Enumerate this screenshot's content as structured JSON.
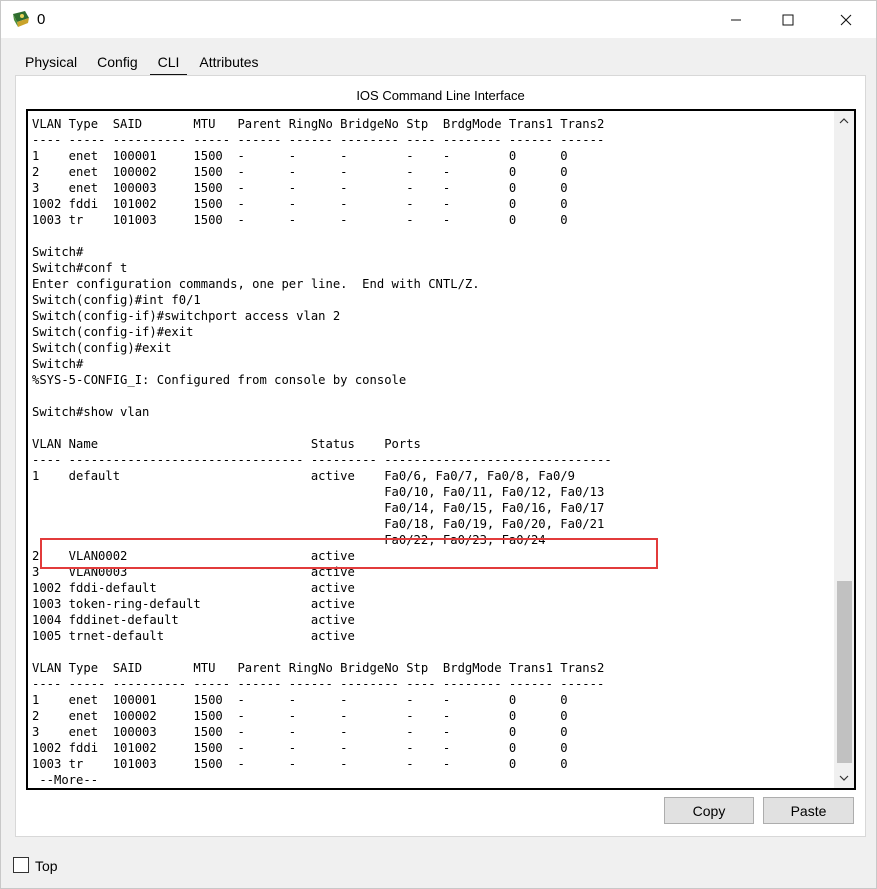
{
  "window": {
    "title": "0",
    "icon": "packet-tracer-switch-icon",
    "controls": [
      "minimize-icon",
      "maximize-icon",
      "close-icon"
    ]
  },
  "tabs": [
    {
      "label": "Physical",
      "active": false
    },
    {
      "label": "Config",
      "active": false
    },
    {
      "label": "CLI",
      "active": true
    },
    {
      "label": "Attributes",
      "active": false
    }
  ],
  "panel": {
    "title": "IOS Command Line Interface"
  },
  "terminal": {
    "lines": [
      "VLAN Type  SAID       MTU   Parent RingNo BridgeNo Stp  BrdgMode Trans1 Trans2",
      "---- ----- ---------- ----- ------ ------ -------- ---- -------- ------ ------",
      "1    enet  100001     1500  -      -      -        -    -        0      0",
      "2    enet  100002     1500  -      -      -        -    -        0      0",
      "3    enet  100003     1500  -      -      -        -    -        0      0",
      "1002 fddi  101002     1500  -      -      -        -    -        0      0",
      "1003 tr    101003     1500  -      -      -        -    -        0      0",
      "",
      "Switch#",
      "Switch#conf t",
      "Enter configuration commands, one per line.  End with CNTL/Z.",
      "Switch(config)#int f0/1",
      "Switch(config-if)#switchport access vlan 2",
      "Switch(config-if)#exit",
      "Switch(config)#exit",
      "Switch#",
      "%SYS-5-CONFIG_I: Configured from console by console",
      "",
      "Switch#show vlan",
      "",
      "VLAN Name                             Status    Ports",
      "---- -------------------------------- --------- -------------------------------",
      "1    default                          active    Fa0/6, Fa0/7, Fa0/8, Fa0/9",
      "                                                Fa0/10, Fa0/11, Fa0/12, Fa0/13",
      "                                                Fa0/14, Fa0/15, Fa0/16, Fa0/17",
      "                                                Fa0/18, Fa0/19, Fa0/20, Fa0/21",
      "                                                Fa0/22, Fa0/23, Fa0/24",
      "2    VLAN0002                         active",
      "3    VLAN0003                         active",
      "1002 fddi-default                     active",
      "1003 token-ring-default               active",
      "1004 fddinet-default                  active",
      "1005 trnet-default                    active",
      "",
      "VLAN Type  SAID       MTU   Parent RingNo BridgeNo Stp  BrdgMode Trans1 Trans2",
      "---- ----- ---------- ----- ------ ------ -------- ---- -------- ------ ------",
      "1    enet  100001     1500  -      -      -        -    -        0      0",
      "2    enet  100002     1500  -      -      -        -    -        0      0",
      "3    enet  100003     1500  -      -      -        -    -        0      0",
      "1002 fddi  101002     1500  -      -      -        -    -        0      0",
      "1003 tr    101003     1500  -      -      -        -    -        0      0",
      " --More--"
    ],
    "highlight_color": "#e23b3b"
  },
  "buttons": {
    "copy": "Copy",
    "paste": "Paste"
  },
  "footer": {
    "top_label": "Top",
    "top_checked": false
  }
}
